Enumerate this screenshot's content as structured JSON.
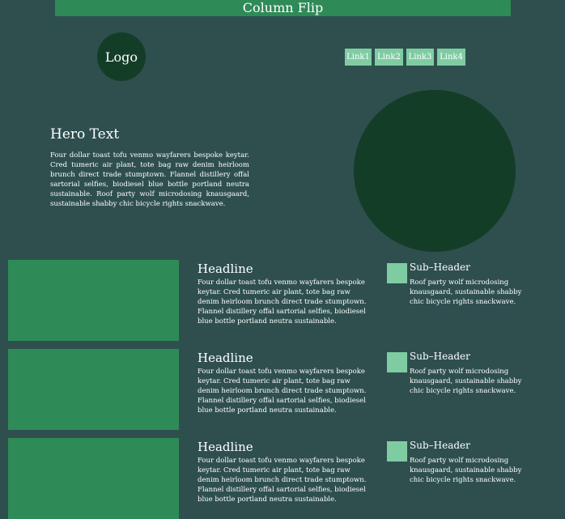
{
  "header": {
    "title": "Column Flip"
  },
  "logo": {
    "label": "Logo"
  },
  "nav": {
    "links": [
      "Link1",
      "Link2",
      "Link3",
      "Link4"
    ]
  },
  "hero": {
    "title": "Hero Text",
    "body": "Four dollar toast tofu venmo wayfarers bespoke keytar. Cred tumeric air plant, tote bag raw denim heirloom brunch direct trade stumptown. Flannel distillery offal sartorial selfies, biodiesel blue bottle portland neutra sustainable. Roof party wolf microdosing knausgaard, sustainable shabby chic bicycle rights snackwave."
  },
  "rows": [
    {
      "headline": "Headline",
      "body": "Four dollar toast tofu venmo wayfarers bespoke keytar. Cred tumeric air plant, tote bag raw denim heirloom brunch direct trade stumptown. Flannel distillery offal sartorial selfies, biodiesel blue bottle portland neutra sustainable.",
      "sub_title": "Sub–Header",
      "sub_body": "Roof party wolf microdosing knausgaard, sustainable shabby chic bicycle rights snackwave."
    },
    {
      "headline": "Headline",
      "body": "Four dollar toast tofu venmo wayfarers bespoke keytar. Cred tumeric air plant, tote bag raw denim heirloom brunch direct trade stumptown. Flannel distillery offal sartorial selfies, biodiesel blue bottle portland neutra sustainable.",
      "sub_title": "Sub–Header",
      "sub_body": "Roof party wolf microdosing knausgaard, sustainable shabby chic bicycle rights snackwave."
    },
    {
      "headline": "Headline",
      "body": "Four dollar toast tofu venmo wayfarers bespoke keytar. Cred tumeric air plant, tote bag raw denim heirloom brunch direct trade stumptown. Flannel distillery offal sartorial selfies, biodiesel blue bottle portland neutra sustainable.",
      "sub_title": "Sub–Header",
      "sub_body": "Roof party wolf microdosing knausgaard, sustainable shabby chic bicycle rights snackwave."
    }
  ],
  "colors": {
    "background": "#2f4f4f",
    "primary_green": "#2e8b57",
    "dark_green": "#143d28",
    "light_green": "#7fcca3"
  }
}
